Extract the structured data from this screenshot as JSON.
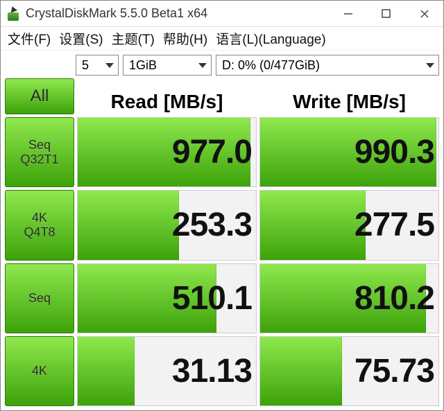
{
  "window": {
    "title": "CrystalDiskMark 5.5.0 Beta1 x64"
  },
  "menu": {
    "file": "文件(F)",
    "settings": "设置(S)",
    "theme": "主题(T)",
    "help": "帮助(H)",
    "language": "语言(L)(Language)"
  },
  "controls": {
    "runs": "5",
    "size": "1GiB",
    "drive": "D: 0% (0/477GiB)"
  },
  "headers": {
    "read": "Read [MB/s]",
    "write": "Write [MB/s]"
  },
  "tests": {
    "all": "All",
    "seqQ32T1": "Seq\nQ32T1",
    "q4T8": "4K\nQ4T8",
    "seq": "Seq",
    "fourK": "4K"
  },
  "results": {
    "seqQ32T1": {
      "read": "977.0",
      "write": "990.3"
    },
    "q4T8": {
      "read": "253.3",
      "write": "277.5"
    },
    "seq": {
      "read": "510.1",
      "write": "810.2"
    },
    "fourK": {
      "read": "31.13",
      "write": "75.73"
    }
  },
  "bars": {
    "seqQ32T1": {
      "read": 97,
      "write": 99
    },
    "q4T8": {
      "read": 57,
      "write": 59
    },
    "seq": {
      "read": 78,
      "write": 93
    },
    "fourK": {
      "read": 32,
      "write": 46
    }
  }
}
